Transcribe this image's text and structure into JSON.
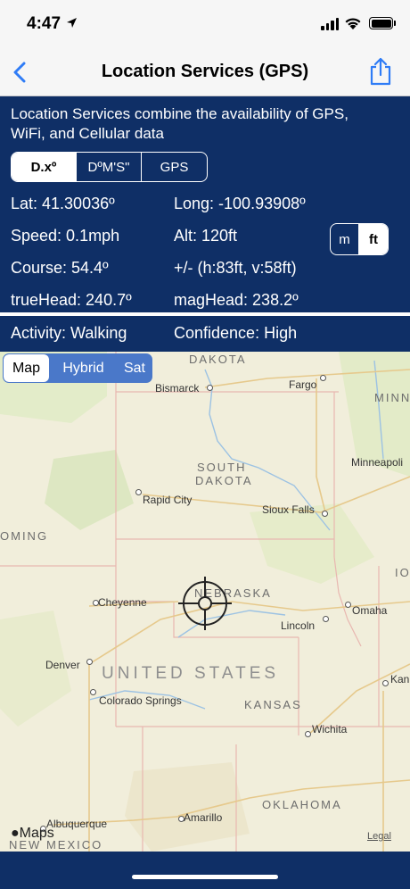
{
  "status_bar": {
    "time": "4:47"
  },
  "nav": {
    "title": "Location Services (GPS)",
    "back_icon": "chevron-left-icon",
    "share_icon": "share-icon",
    "accent_color": "#2f7cf6"
  },
  "info": {
    "description_line1": "Location Services combine the availability of GPS,",
    "description_line2": "WiFi, and Cellular data",
    "format_options": [
      "D.xº",
      "DºM'S\"",
      "GPS"
    ],
    "format_selected": "D.xº",
    "unit_options": [
      "m",
      "ft"
    ],
    "unit_selected": "ft",
    "lat": "Lat:  41.30036º",
    "long": "Long: -100.93908º",
    "speed": "Speed:  0.1mph",
    "alt": "Alt:  120ft",
    "course": "Course:  54.4º",
    "accuracy": "+/- (h:83ft, v:58ft)",
    "true_head": "trueHead: 240.7º",
    "mag_head": "magHead: 238.2º",
    "activity": "Activity: Walking",
    "confidence": "Confidence: High",
    "panel_color": "#0f2f66"
  },
  "map": {
    "type_options": [
      "Map",
      "Hybrid",
      "Sat"
    ],
    "type_selected": "Map",
    "cities": {
      "bismarck": "Bismarck",
      "fargo": "Fargo",
      "minneapolis": "Minneapoli",
      "rapid_city": "Rapid City",
      "sioux_falls": "Sioux Falls",
      "cheyenne": "Cheyenne",
      "omaha": "Omaha",
      "lincoln": "Lincoln",
      "denver": "Denver",
      "colorado_springs": "Colorado Springs",
      "wichita": "Wichita",
      "kan": "Kan",
      "amarillo": "Amarillo",
      "albuquerque": "Albuquerque"
    },
    "states": {
      "dakota_north": "DAKOTA",
      "minn": "MINN",
      "south": "SOUTH",
      "dakota_south": "DAKOTA",
      "oming": "OMING",
      "io": "IO",
      "nebraska": "NEBRASKA",
      "kansas": "KANSAS",
      "oklahoma": "OKLAHOMA",
      "new_mexico": "NEW MEXICO"
    },
    "country": "UNITED STATES",
    "brand": "Maps",
    "legal": "Legal",
    "crosshair_icon": "crosshair-icon"
  }
}
